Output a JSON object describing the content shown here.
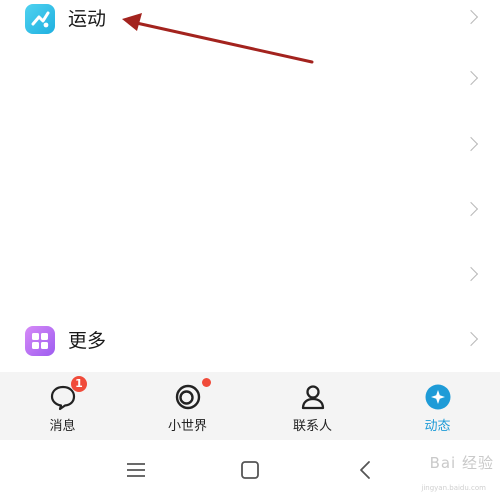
{
  "list": {
    "items": [
      {
        "label": "运动",
        "icon": "running-icon",
        "color": "#35c3e8"
      },
      {
        "label": "",
        "icon": "",
        "color": ""
      },
      {
        "label": "",
        "icon": "",
        "color": ""
      },
      {
        "label": "",
        "icon": "",
        "color": ""
      },
      {
        "label": "",
        "icon": "",
        "color": ""
      },
      {
        "label": "更多",
        "icon": "grid-more-icon",
        "color": "#b46ef2"
      }
    ]
  },
  "tabbar": {
    "tabs": [
      {
        "label": "消息",
        "icon": "message-bubble-icon",
        "badge": "1",
        "active": false
      },
      {
        "label": "小世界",
        "icon": "small-world-icon",
        "dot": true,
        "active": false
      },
      {
        "label": "联系人",
        "icon": "contact-person-icon",
        "active": false
      },
      {
        "label": "动态",
        "icon": "star-planet-icon",
        "active": true
      }
    ],
    "accent": "#1e9bd7",
    "badge_color": "#f04b3a"
  },
  "system_nav": {
    "buttons": [
      "menu-icon",
      "home-icon",
      "back-icon"
    ]
  },
  "watermark": {
    "text": "Bai 经验",
    "sub": "jingyan.baidu.com"
  },
  "annotation": {
    "arrow_color": "#a3231e"
  }
}
